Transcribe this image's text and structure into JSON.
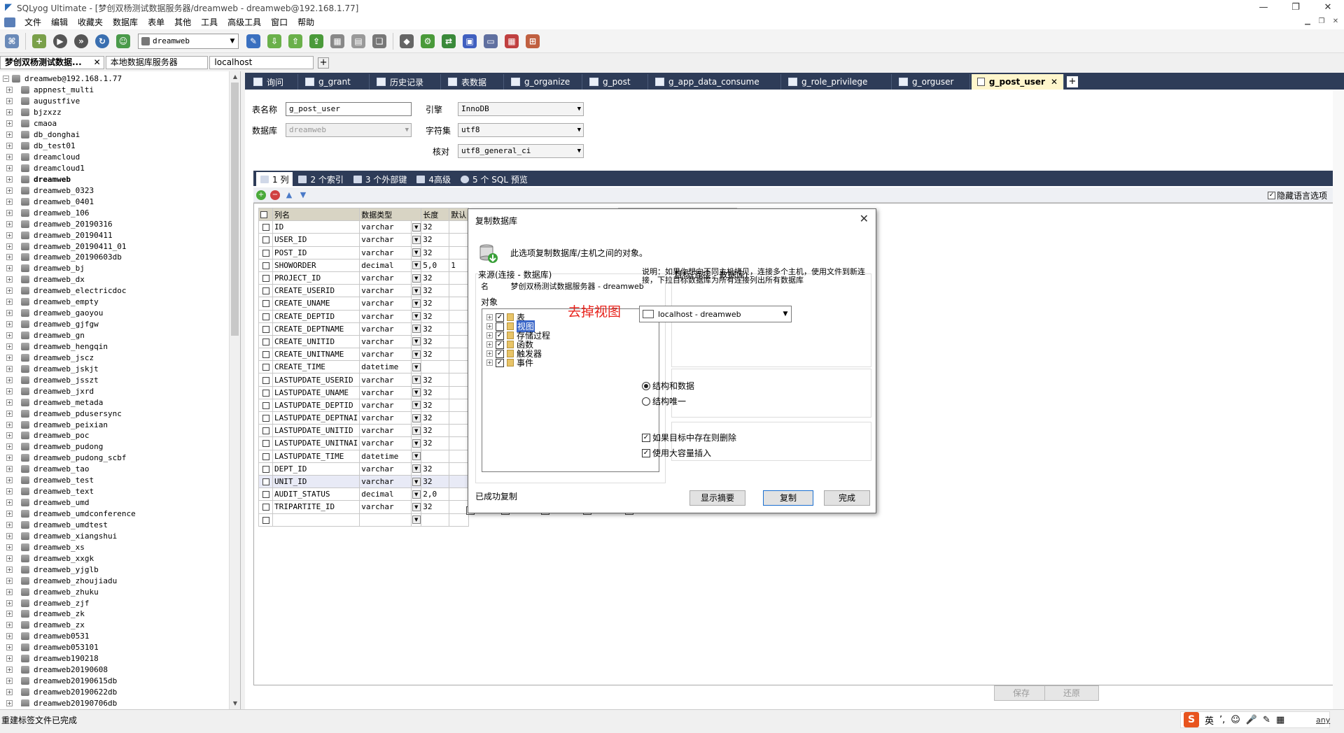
{
  "window": {
    "title": "SQLyog Ultimate - [梦创双杨测试数据服务器/dreamweb - dreamweb@192.168.1.77]",
    "controls": [
      "—",
      "❐",
      "✕"
    ]
  },
  "menu": {
    "items": [
      "文件",
      "编辑",
      "收藏夹",
      "数据库",
      "表单",
      "其他",
      "工具",
      "高级工具",
      "窗口",
      "帮助"
    ]
  },
  "toolbar": {
    "db_select_value": "dreamweb"
  },
  "connection_tabs": [
    {
      "label": "梦创双杨测试数据...",
      "active": true,
      "close": "✕"
    },
    {
      "label": "本地数据库服务器",
      "active": false
    },
    {
      "label": "localhost",
      "active": false
    }
  ],
  "tree": {
    "root": "dreamweb@192.168.1.77",
    "items": [
      "appnest_multi",
      "augustfive",
      "bjzxzz",
      "cmaoa",
      "db_donghai",
      "db_test01",
      "dreamcloud",
      "dreamcloud1",
      "dreamweb",
      "dreamweb_0323",
      "dreamweb_0401",
      "dreamweb_106",
      "dreamweb_20190316",
      "dreamweb_20190411",
      "dreamweb_20190411_01",
      "dreamweb_20190603db",
      "dreamweb_bj",
      "dreamweb_dx",
      "dreamweb_electricdoc",
      "dreamweb_empty",
      "dreamweb_gaoyou",
      "dreamweb_gjfgw",
      "dreamweb_gn",
      "dreamweb_hengqin",
      "dreamweb_jscz",
      "dreamweb_jskjt",
      "dreamweb_jsszt",
      "dreamweb_jxrd",
      "dreamweb_metada",
      "dreamweb_pdusersync",
      "dreamweb_peixian",
      "dreamweb_poc",
      "dreamweb_pudong",
      "dreamweb_pudong_scbf",
      "dreamweb_tao",
      "dreamweb_test",
      "dreamweb_text",
      "dreamweb_umd",
      "dreamweb_umdconference",
      "dreamweb_umdtest",
      "dreamweb_xiangshui",
      "dreamweb_xs",
      "dreamweb_xxgk",
      "dreamweb_yjglb",
      "dreamweb_zhoujiadu",
      "dreamweb_zhuku",
      "dreamweb_zjf",
      "dreamweb_zk",
      "dreamweb_zx",
      "dreamweb0531",
      "dreamweb053101",
      "dreamweb190218",
      "dreamweb20190608",
      "dreamweb20190615db",
      "dreamweb20190622db",
      "dreamweb20190706db"
    ],
    "bold_item": "dreamweb"
  },
  "doc_tabs": [
    {
      "label": "询问"
    },
    {
      "label": "g_grant"
    },
    {
      "label": "历史记录"
    },
    {
      "label": "表数据"
    },
    {
      "label": "g_organize"
    },
    {
      "label": "g_post"
    },
    {
      "label": "g_app_data_consume"
    },
    {
      "label": "g_role_privilege"
    },
    {
      "label": "g_orguser"
    },
    {
      "label": "g_post_user",
      "active": true,
      "close": "✕"
    }
  ],
  "table_form": {
    "table_name_label": "表名称",
    "table_name_value": "g_post_user",
    "database_label": "数据库",
    "database_value": "dreamweb",
    "engine_label": "引擎",
    "engine_value": "InnoDB",
    "charset_label": "字符集",
    "charset_value": "utf8",
    "collation_label": "核对",
    "collation_value": "utf8_general_ci"
  },
  "sub_tabs": [
    "1 列",
    "2 个索引",
    "3 个外部键",
    "4高级",
    "5 个 SQL 预览"
  ],
  "hide_language_label": "隐藏语言选项",
  "columns_grid": {
    "headers": [
      "列名",
      "数据类型",
      "长度",
      "默认"
    ],
    "rows": [
      {
        "name": "ID",
        "type": "varchar",
        "len": "32",
        "def": ""
      },
      {
        "name": "USER_ID",
        "type": "varchar",
        "len": "32",
        "def": ""
      },
      {
        "name": "POST_ID",
        "type": "varchar",
        "len": "32",
        "def": ""
      },
      {
        "name": "SHOWORDER",
        "type": "decimal",
        "len": "5,0",
        "def": "1"
      },
      {
        "name": "PROJECT_ID",
        "type": "varchar",
        "len": "32",
        "def": ""
      },
      {
        "name": "CREATE_USERID",
        "type": "varchar",
        "len": "32",
        "def": ""
      },
      {
        "name": "CREATE_UNAME",
        "type": "varchar",
        "len": "32",
        "def": ""
      },
      {
        "name": "CREATE_DEPTID",
        "type": "varchar",
        "len": "32",
        "def": ""
      },
      {
        "name": "CREATE_DEPTNAME",
        "type": "varchar",
        "len": "32",
        "def": ""
      },
      {
        "name": "CREATE_UNITID",
        "type": "varchar",
        "len": "32",
        "def": ""
      },
      {
        "name": "CREATE_UNITNAME",
        "type": "varchar",
        "len": "32",
        "def": ""
      },
      {
        "name": "CREATE_TIME",
        "type": "datetime",
        "len": "",
        "def": ""
      },
      {
        "name": "LASTUPDATE_USERID",
        "type": "varchar",
        "len": "32",
        "def": ""
      },
      {
        "name": "LASTUPDATE_UNAME",
        "type": "varchar",
        "len": "32",
        "def": ""
      },
      {
        "name": "LASTUPDATE_DEPTID",
        "type": "varchar",
        "len": "32",
        "def": ""
      },
      {
        "name": "LASTUPDATE_DEPTNAI",
        "type": "varchar",
        "len": "32",
        "def": ""
      },
      {
        "name": "LASTUPDATE_UNITID",
        "type": "varchar",
        "len": "32",
        "def": ""
      },
      {
        "name": "LASTUPDATE_UNITNAI",
        "type": "varchar",
        "len": "32",
        "def": ""
      },
      {
        "name": "LASTUPDATE_TIME",
        "type": "datetime",
        "len": "",
        "def": ""
      },
      {
        "name": "DEPT_ID",
        "type": "varchar",
        "len": "32",
        "def": ""
      },
      {
        "name": "UNIT_ID",
        "type": "varchar",
        "len": "32",
        "def": "",
        "highlight": true
      },
      {
        "name": "AUDIT_STATUS",
        "type": "decimal",
        "len": "2,0",
        "def": ""
      },
      {
        "name": "TRIPARTITE_ID",
        "type": "varchar",
        "len": "32",
        "def": ""
      },
      {
        "name": "",
        "type": "",
        "len": "",
        "def": ""
      }
    ]
  },
  "buttons": {
    "save": "保存",
    "revert": "还原"
  },
  "dialog": {
    "title": "复制数据库",
    "close": "✕",
    "description": "此选项复制数据库/主机之间的对象。",
    "source_label": "来源(连接 - 数据库)",
    "source_name_key": "名",
    "source_name_value": "梦创双杨测试数据服务器 - dreamweb",
    "objects_label": "对象",
    "objects": [
      {
        "label": "表",
        "checked": true
      },
      {
        "label": "视图",
        "checked": false,
        "selected": true
      },
      {
        "label": "存储过程",
        "checked": true
      },
      {
        "label": "函数",
        "checked": true
      },
      {
        "label": "触发器",
        "checked": true
      },
      {
        "label": "事件",
        "checked": true
      }
    ],
    "annotation": "去掉视图",
    "target_label": "目标(连接 - 数据库)",
    "target_desc": "说明：如果你想向不同主机拷贝，连接多个主机，使用文件到新连接，下拉目标数据库为所有连接列出所有数据库",
    "target_value": "localhost - dreamweb",
    "radio_structure_data": "结构和数据",
    "radio_structure_only": "结构唯一",
    "check_drop_if_exists": "如果目标中存在则删除",
    "check_bulk_insert": "使用大容量插入",
    "status_message": "已成功复制",
    "btn_show_summary": "显示摘要",
    "btn_copy": "复制",
    "btn_done": "完成"
  },
  "statusbar": {
    "text": "重建标签文件已完成",
    "ime_lang": "英",
    "ime_extra": "any"
  }
}
